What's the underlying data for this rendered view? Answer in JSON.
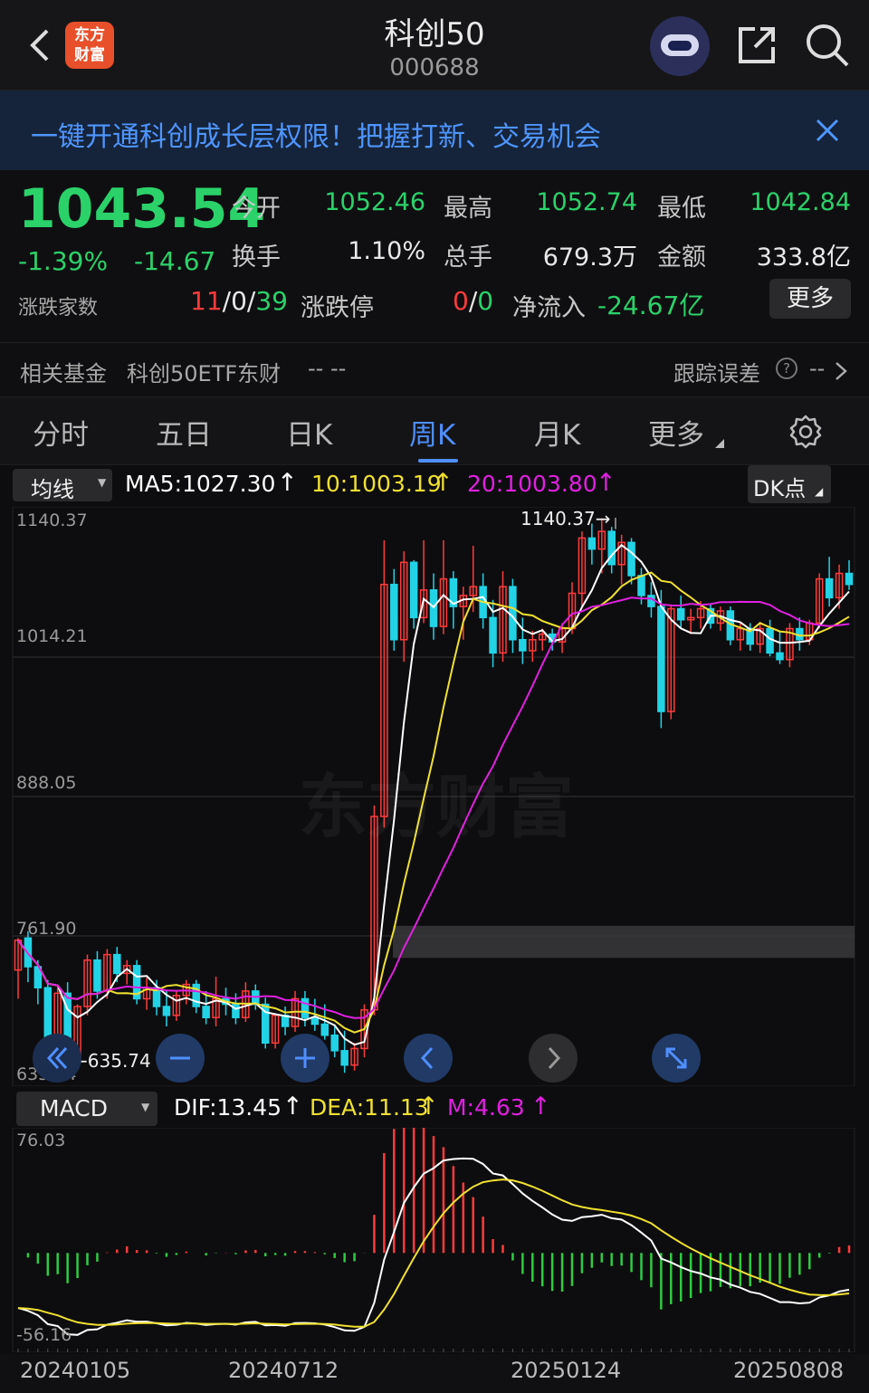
{
  "header": {
    "title": "科创50",
    "code": "000688",
    "logo_text": "东方财富"
  },
  "banner": {
    "text": "一键开通科创成长层权限！把握打新、交易机会"
  },
  "quote": {
    "price": "1043.54",
    "change_pct": "-1.39%",
    "change": "-14.67",
    "open_label": "今开",
    "open": "1052.46",
    "high_label": "最高",
    "high": "1052.74",
    "low_label": "最低",
    "low": "1042.84",
    "turnover_label": "换手",
    "turnover": "1.10%",
    "volume_label": "总手",
    "volume": "679.3万",
    "amount_label": "金额",
    "amount": "333.8亿",
    "breadth_label": "涨跌家数",
    "breadth_up": "11",
    "breadth_sep1": "/",
    "breadth_flat": "0",
    "breadth_sep2": "/",
    "breadth_down": "39",
    "limit_label": "涨跌停",
    "limit_up": "0",
    "limit_sep": "/",
    "limit_down": "0",
    "netflow_label": "净流入",
    "netflow": "-24.67亿",
    "more_button": "更多",
    "fund_label": "相关基金",
    "fund_name": "科创50ETF东财",
    "fund_value": "-- --",
    "tracking_label": "跟踪误差",
    "tracking_value": "--"
  },
  "tabs": [
    "分时",
    "五日",
    "日K",
    "周K",
    "月K",
    "更多"
  ],
  "active_tab": "周K",
  "ma": {
    "selector": "均线",
    "ma5": "MA5:1027.30",
    "ma10": "10:1003.19",
    "ma20": "20:1003.80",
    "dk": "DK点",
    "ma5_color": "#ffffff",
    "ma10_color": "#f0e030",
    "ma20_color": "#e020e0"
  },
  "price_axis": {
    "t1": "1140.37",
    "t2": "1014.21",
    "t3": "888.05",
    "t4": "761.90",
    "t5": "635.74"
  },
  "annotations": {
    "max": "1140.37",
    "min": "635.74"
  },
  "watermark": "东方财富",
  "macd": {
    "selector": "MACD",
    "dif": "DIF:13.45",
    "dea": "DEA:11.13",
    "m": "M:4.63",
    "top": "76.03",
    "bottom": "-56.16"
  },
  "dates": [
    "20240105",
    "20240712",
    "20250124",
    "20250808"
  ],
  "chart_data": {
    "type": "candlestick",
    "period": "weekly",
    "ylim": [
      635.74,
      1140.37
    ],
    "candles": [
      [
        731,
        760,
        705,
        758
      ],
      [
        760,
        766,
        720,
        734
      ],
      [
        734,
        740,
        700,
        715
      ],
      [
        715,
        722,
        650,
        668
      ],
      [
        668,
        715,
        640,
        710
      ],
      [
        710,
        720,
        640,
        650
      ],
      [
        650,
        700,
        645,
        698
      ],
      [
        698,
        745,
        690,
        740
      ],
      [
        740,
        748,
        705,
        712
      ],
      [
        712,
        750,
        705,
        745
      ],
      [
        745,
        752,
        720,
        728
      ],
      [
        728,
        740,
        718,
        735
      ],
      [
        735,
        740,
        700,
        705
      ],
      [
        705,
        724,
        695,
        715
      ],
      [
        715,
        722,
        690,
        698
      ],
      [
        698,
        712,
        680,
        690
      ],
      [
        690,
        712,
        685,
        708
      ],
      [
        708,
        722,
        700,
        718
      ],
      [
        718,
        722,
        692,
        698
      ],
      [
        698,
        712,
        682,
        688
      ],
      [
        688,
        725,
        680,
        705
      ],
      [
        705,
        715,
        690,
        700
      ],
      [
        700,
        710,
        682,
        688
      ],
      [
        688,
        720,
        684,
        712
      ],
      [
        712,
        718,
        695,
        700
      ],
      [
        700,
        706,
        660,
        665
      ],
      [
        665,
        692,
        660,
        690
      ],
      [
        690,
        698,
        672,
        680
      ],
      [
        680,
        712,
        675,
        705
      ],
      [
        705,
        712,
        680,
        688
      ],
      [
        688,
        705,
        676,
        682
      ],
      [
        682,
        700,
        668,
        672
      ],
      [
        672,
        682,
        652,
        658
      ],
      [
        658,
        676,
        638,
        645
      ],
      [
        645,
        665,
        640,
        660
      ],
      [
        660,
        700,
        652,
        695
      ],
      [
        695,
        880,
        690,
        870
      ],
      [
        870,
        1120,
        860,
        1080
      ],
      [
        1080,
        1094,
        1020,
        1030
      ],
      [
        1030,
        1110,
        1010,
        1100
      ],
      [
        1100,
        1102,
        1040,
        1050
      ],
      [
        1050,
        1120,
        1045,
        1075
      ],
      [
        1075,
        1090,
        1030,
        1042
      ],
      [
        1042,
        1120,
        1035,
        1085
      ],
      [
        1085,
        1092,
        1040,
        1060
      ],
      [
        1060,
        1078,
        1030,
        1070
      ],
      [
        1070,
        1115,
        1055,
        1078
      ],
      [
        1078,
        1090,
        1040,
        1050
      ],
      [
        1050,
        1066,
        1005,
        1018
      ],
      [
        1018,
        1092,
        1010,
        1078
      ],
      [
        1078,
        1085,
        1018,
        1030
      ],
      [
        1030,
        1050,
        1008,
        1020
      ],
      [
        1020,
        1038,
        1010,
        1030
      ],
      [
        1030,
        1040,
        1020,
        1035
      ],
      [
        1035,
        1040,
        1020,
        1028
      ],
      [
        1028,
        1045,
        1018,
        1040
      ],
      [
        1040,
        1082,
        1035,
        1072
      ],
      [
        1072,
        1128,
        1060,
        1122
      ],
      [
        1122,
        1135,
        1098,
        1112
      ],
      [
        1112,
        1140,
        1090,
        1128
      ],
      [
        1128,
        1132,
        1090,
        1098
      ],
      [
        1098,
        1125,
        1080,
        1118
      ],
      [
        1118,
        1122,
        1080,
        1088
      ],
      [
        1088,
        1095,
        1062,
        1070
      ],
      [
        1070,
        1082,
        1050,
        1060
      ],
      [
        1060,
        1075,
        950,
        965
      ],
      [
        965,
        1062,
        958,
        1058
      ],
      [
        1058,
        1070,
        1040,
        1048
      ],
      [
        1048,
        1058,
        1035,
        1050
      ],
      [
        1050,
        1065,
        1040,
        1058
      ],
      [
        1058,
        1062,
        1040,
        1045
      ],
      [
        1045,
        1060,
        1038,
        1056
      ],
      [
        1056,
        1060,
        1025,
        1030
      ],
      [
        1030,
        1045,
        1020,
        1040
      ],
      [
        1040,
        1045,
        1020,
        1026
      ],
      [
        1026,
        1046,
        1018,
        1040
      ],
      [
        1040,
        1048,
        1015,
        1018
      ],
      [
        1018,
        1038,
        1008,
        1012
      ],
      [
        1012,
        1045,
        1005,
        1040
      ],
      [
        1040,
        1050,
        1020,
        1030
      ],
      [
        1030,
        1048,
        1025,
        1045
      ],
      [
        1045,
        1090,
        1040,
        1085
      ],
      [
        1085,
        1105,
        1060,
        1068
      ],
      [
        1068,
        1098,
        1058,
        1090
      ],
      [
        1090,
        1102,
        1075,
        1080
      ]
    ],
    "ma_current": {
      "MA5": 1027.3,
      "MA10": 1003.19,
      "MA20": 1003.8
    },
    "macd_current": {
      "DIF": 13.45,
      "DEA": 11.13,
      "M": 4.63
    },
    "macd_range": [
      -56.16,
      76.03
    ]
  }
}
